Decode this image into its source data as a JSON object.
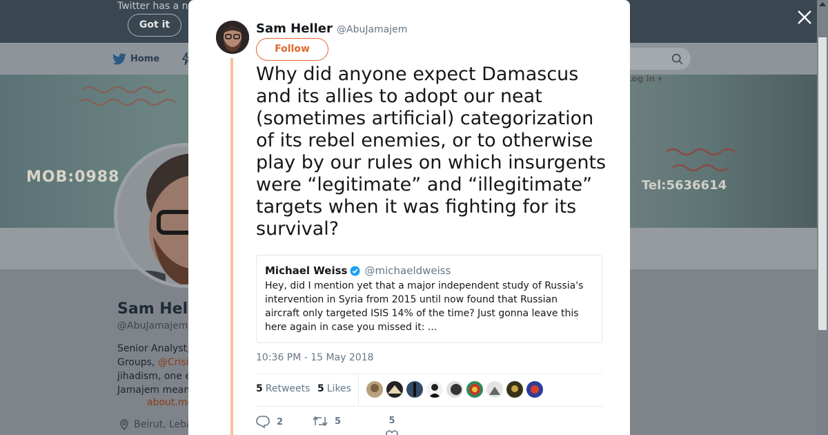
{
  "banner": {
    "message": "Twitter has a n",
    "got_it_label": "Got it"
  },
  "nav": {
    "home_label": "Home",
    "login_label": "Log in ▾"
  },
  "cover": {
    "sign_left": "MOB:0988",
    "sign_right": "Tel:5636614"
  },
  "profile": {
    "name": "Sam Hell",
    "handle": "@AbuJamajem",
    "bio_line1": "Senior Analyst,",
    "bio_line2_prefix": "Groups, ",
    "bio_line2_link": "@Crisi",
    "bio_line3": "jihadism, one e",
    "bio_line4": "Jamajem mean",
    "link": "about.me",
    "location": "Beirut, Leba"
  },
  "tweet": {
    "author_name": "Sam Heller",
    "author_handle": "@AbuJamajem",
    "follow_label": "Follow",
    "text": "Why did anyone expect Damascus and its allies to adopt our neat (sometimes artificial) categorization of its rebel enemies, or to otherwise play by our rules on which insurgents were “legitimate” and “illegitimate” targets when it was fighting for its survival?",
    "quote": {
      "name": "Michael Weiss",
      "handle": "@michaeldweiss",
      "text": "Hey, did I mention yet that a major independent study of Russia's intervention in Syria from 2015 until now found that Russian aircraft only targeted ISIS 14% of the time? Just gonna leave this here again in case you missed it: ..."
    },
    "timestamp": "10:36 PM - 15 May 2018",
    "retweets_count": "5",
    "retweets_label": "Retweets",
    "likes_count": "5",
    "likes_label": "Likes",
    "reply_count": "2",
    "retweet_action_count": "5",
    "like_action_count": "5"
  },
  "colors": {
    "accent": "#e0662b",
    "thread": "#f9bf9b",
    "verified": "#1da1f2",
    "text": "#14171a",
    "muted": "#657786"
  },
  "icons": [
    "close-icon",
    "twitter-bird-icon",
    "search-icon",
    "verified-icon",
    "reply-icon",
    "retweet-icon",
    "heart-icon",
    "location-icon"
  ]
}
